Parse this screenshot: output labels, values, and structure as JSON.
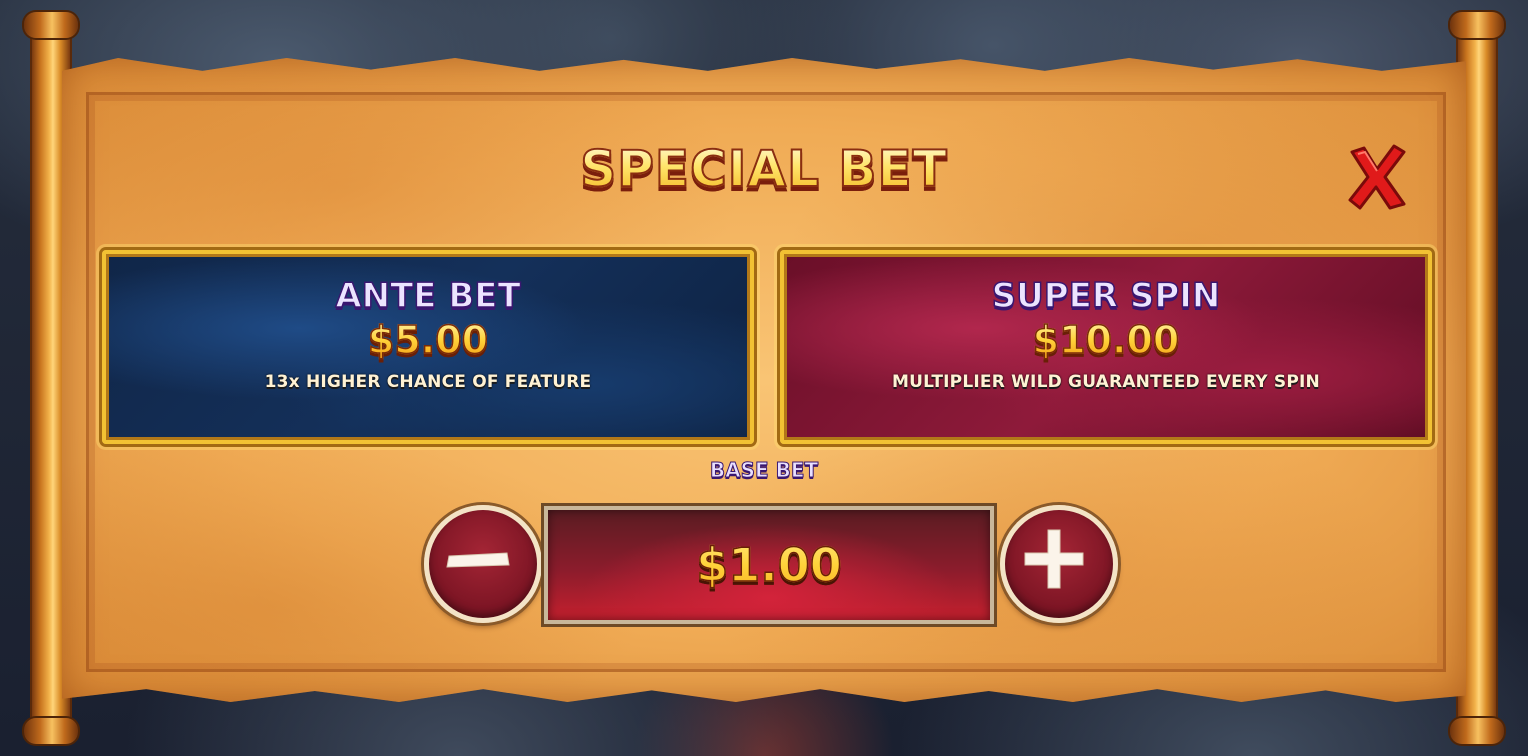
{
  "dialog": {
    "title": "SPECIAL BET",
    "close_icon": "close-x-icon"
  },
  "options": [
    {
      "title": "ANTE BET",
      "price": "$5.00",
      "description": "13x HIGHER CHANCE OF FEATURE",
      "color": "#14305a"
    },
    {
      "title": "SUPER SPIN",
      "price": "$10.00",
      "description": "MULTIPLIER WILD GUARANTEED EVERY SPIN",
      "color": "#8e1a3a"
    }
  ],
  "base_bet": {
    "label": "BASE BET",
    "value": "$1.00",
    "decrease_icon": "minus-icon",
    "increase_icon": "plus-icon"
  },
  "colors": {
    "parchment": "#f0ab55",
    "gold_border": "#f2c233",
    "close_red": "#e01a1a",
    "button_red": "#7a1423"
  }
}
